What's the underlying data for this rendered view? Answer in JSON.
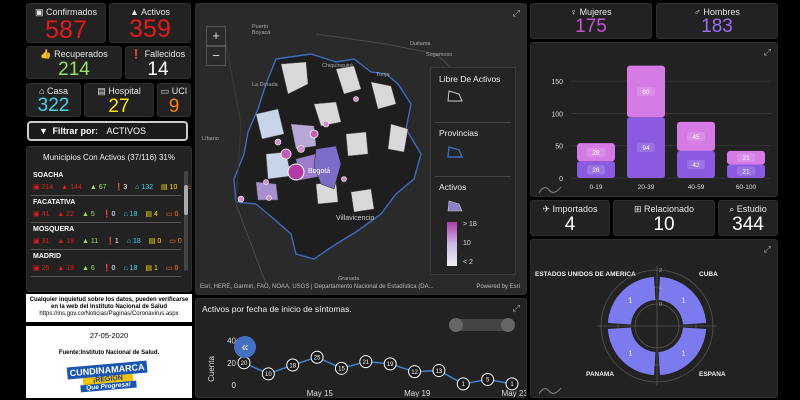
{
  "kpi": {
    "confirmados": {
      "label": "Confirmados",
      "value": "587",
      "icon": "chart-bar-icon",
      "color": "#e31a1c"
    },
    "activos": {
      "label": "Activos",
      "value": "359",
      "icon": "alert-icon",
      "color": "#e31a1c"
    },
    "recuperados": {
      "label": "Recuperados",
      "value": "214",
      "icon": "thumbs-up-icon",
      "color": "#98e060"
    },
    "fallecidos": {
      "label": "Fallecidos",
      "value": "14",
      "icon": "exclamation-icon",
      "color": "#ffffff"
    },
    "casa": {
      "label": "Casa",
      "value": "322",
      "icon": "home-icon",
      "color": "#3ad7f0"
    },
    "hospital": {
      "label": "Hospital",
      "value": "27",
      "icon": "hospital-icon",
      "color": "#ffe400"
    },
    "uci": {
      "label": "UCI",
      "value": "9",
      "icon": "bed-icon",
      "color": "#ff7f00"
    }
  },
  "filter": {
    "label": "Filtrar por:",
    "value": "ACTIVOS"
  },
  "municipios": {
    "title": "Municipios Con Activos (37/116) 31%",
    "rows": [
      {
        "name": "SOACHA",
        "s1": "214",
        "s2": "144",
        "s3": "67",
        "s4": "3",
        "s5": "132",
        "s6": "10",
        "s7": "2"
      },
      {
        "name": "FACATATIVA",
        "s1": "41",
        "s2": "22",
        "s3": "5",
        "s4": "0",
        "s5": "18",
        "s6": "4",
        "s7": "0"
      },
      {
        "name": "MOSQUERA",
        "s1": "31",
        "s2": "19",
        "s3": "11",
        "s4": "1",
        "s5": "18",
        "s6": "0",
        "s7": "0"
      },
      {
        "name": "MADRID",
        "s1": "25",
        "s2": "19",
        "s3": "6",
        "s4": "0",
        "s5": "18",
        "s6": "1",
        "s7": "0"
      }
    ]
  },
  "info": {
    "text1": "Cualquier inquietud sobre los datos, pueden verificarse en la web del Instituto Nacional de Salud",
    "url": "https://ins.gov.co/Noticias/Paginas/Coronavirus.aspx",
    "date": "27-05-2020",
    "source": "Fuente:Instituto Nacional de Salud.",
    "logo_line1": "CUNDINAMARCA",
    "logo_line2": "¡REGIÓN",
    "logo_line3": "Que Progresa!"
  },
  "map": {
    "places": [
      "Puerto Boyacá",
      "Duitama",
      "Sogamoso",
      "Chiquinquirá",
      "Tunja",
      "La Dorada",
      "Líbano",
      "Bogotá",
      "Villavicencio",
      "Granada"
    ],
    "attribution": "Esri, HERE, Garmin, FAO, NOAA, USGS | Departamento Nacional de Estadística (DA...",
    "powered": "Powered by Esri",
    "zoom_in": "+",
    "zoom_out": "−",
    "legend": {
      "libre": "Libre De Activos",
      "provincias": "Provincias",
      "activos": "Activos",
      "scale_high": "> 18",
      "scale_mid": "10",
      "scale_low": "< 2"
    }
  },
  "gender": {
    "mujeres": {
      "label": "Mujeres",
      "value": "175",
      "color": "#c653d6",
      "icon": "female-icon"
    },
    "hombres": {
      "label": "Hombres",
      "value": "183",
      "color": "#9b6ef2",
      "icon": "male-icon"
    }
  },
  "age_chart": {
    "chart_data": {
      "type": "bar",
      "stacked": true,
      "categories": [
        "0-19",
        "20-39",
        "40-59",
        "60-100"
      ],
      "series": [
        {
          "values": [
            26,
            94,
            42,
            21
          ],
          "color": "#8a5be0"
        },
        {
          "values": [
            28,
            80,
            45,
            21
          ],
          "color": "#d67ae6"
        }
      ],
      "ylim": [
        0,
        175
      ],
      "yticks": [
        0,
        50,
        100,
        150
      ]
    }
  },
  "origin": {
    "importados": {
      "label": "Importados",
      "value": "4",
      "icon": "plane-icon"
    },
    "relacionado": {
      "label": "Relacionado",
      "value": "10",
      "icon": "network-icon"
    },
    "estudio": {
      "label": "Estudio",
      "value": "344",
      "icon": "search-icon"
    }
  },
  "countries_chart": {
    "chart_data": {
      "type": "radial",
      "categories": [
        "ESTADOS UNIDOS DE AMERICA",
        "CUBA",
        "ESPANA",
        "PANAMA"
      ],
      "values": [
        1,
        1,
        1,
        1
      ],
      "axis_max": 2,
      "axis_ticks": [
        "2",
        "1",
        "0"
      ],
      "color": "#7b7bef"
    }
  },
  "timeline": {
    "title": "Activos por fecha de inicio de síntomas.",
    "chart_data": {
      "type": "line",
      "ylabel": "Cuenta",
      "yticks": [
        0,
        20,
        40
      ],
      "ylim": [
        0,
        45
      ],
      "xticks": [
        "May 15",
        "May 19",
        "May 23"
      ],
      "values": [
        20,
        10,
        18,
        25,
        15,
        21,
        19,
        12,
        13,
        1,
        5,
        1
      ],
      "color": "#3f82c9",
      "handle_label": "20"
    }
  }
}
